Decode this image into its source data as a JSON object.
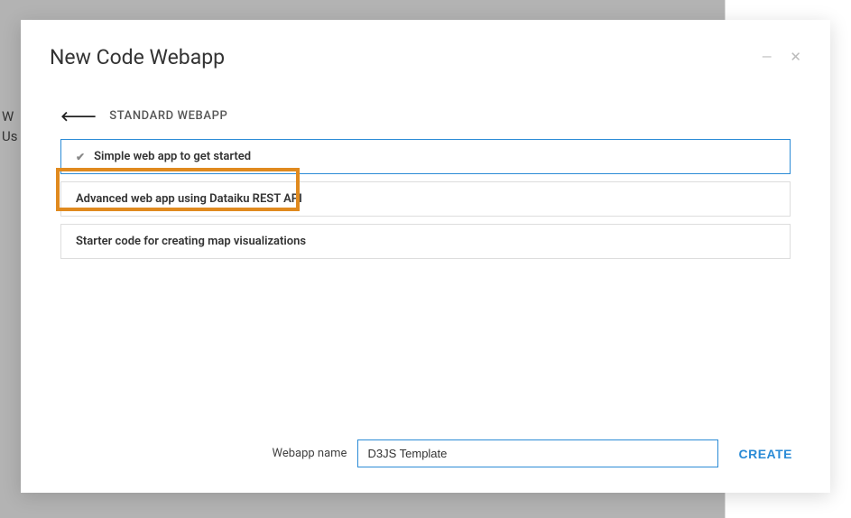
{
  "background": {
    "line1": "W",
    "line2": "Us"
  },
  "modal": {
    "title": "New Code Webapp",
    "breadcrumb": "STANDARD WEBAPP",
    "options": [
      {
        "label": "Simple web app to get started",
        "selected": true
      },
      {
        "label": "Advanced web app using Dataiku REST API",
        "selected": false
      },
      {
        "label": "Starter code for creating map visualizations",
        "selected": false
      }
    ],
    "footer": {
      "label": "Webapp name",
      "value": "D3JS Template",
      "create": "CREATE"
    }
  }
}
